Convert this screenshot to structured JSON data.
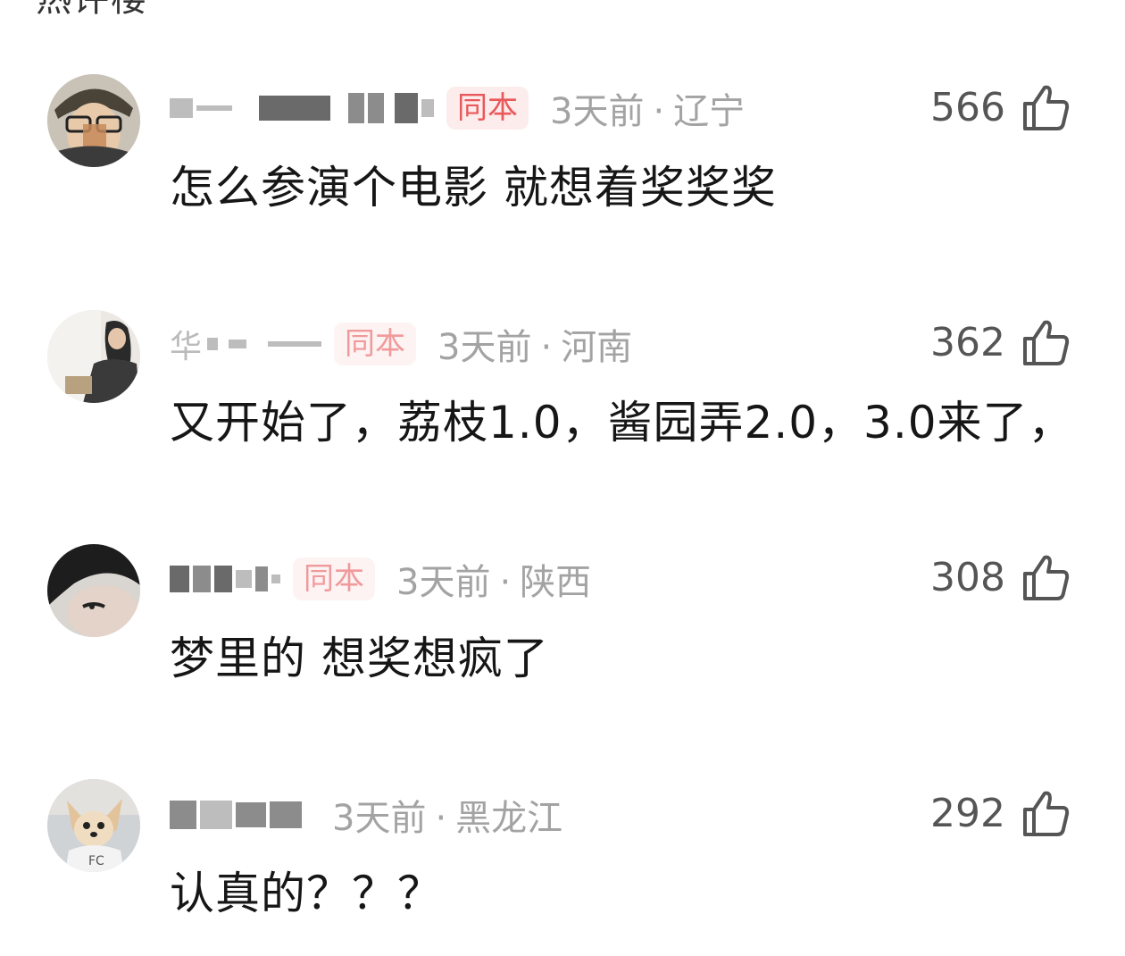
{
  "header": {
    "partial_title": "热评楼"
  },
  "comments": [
    {
      "badge": "同本",
      "time": "3天前",
      "location": "辽宁",
      "likes": "566",
      "text": "怎么参演个电影 就想着奖奖奖"
    },
    {
      "badge": "同本",
      "time": "3天前",
      "location": "河南",
      "likes": "362",
      "text": "又开始了，荔枝1.0，酱园弄2.0，3.0来了，"
    },
    {
      "badge": "同本",
      "time": "3天前",
      "location": "陕西",
      "likes": "308",
      "text": "梦里的 想奖想疯了"
    },
    {
      "badge": "",
      "time": "3天前",
      "location": "黑龙江",
      "likes": "292",
      "text": "认真的？？？"
    }
  ],
  "icons": {
    "like": "thumbs-up-icon",
    "separator": "·"
  },
  "colors": {
    "badge_text": "#e9585a",
    "badge_bg": "#fdecec",
    "meta": "#a3a3a3",
    "content": "#161616"
  }
}
